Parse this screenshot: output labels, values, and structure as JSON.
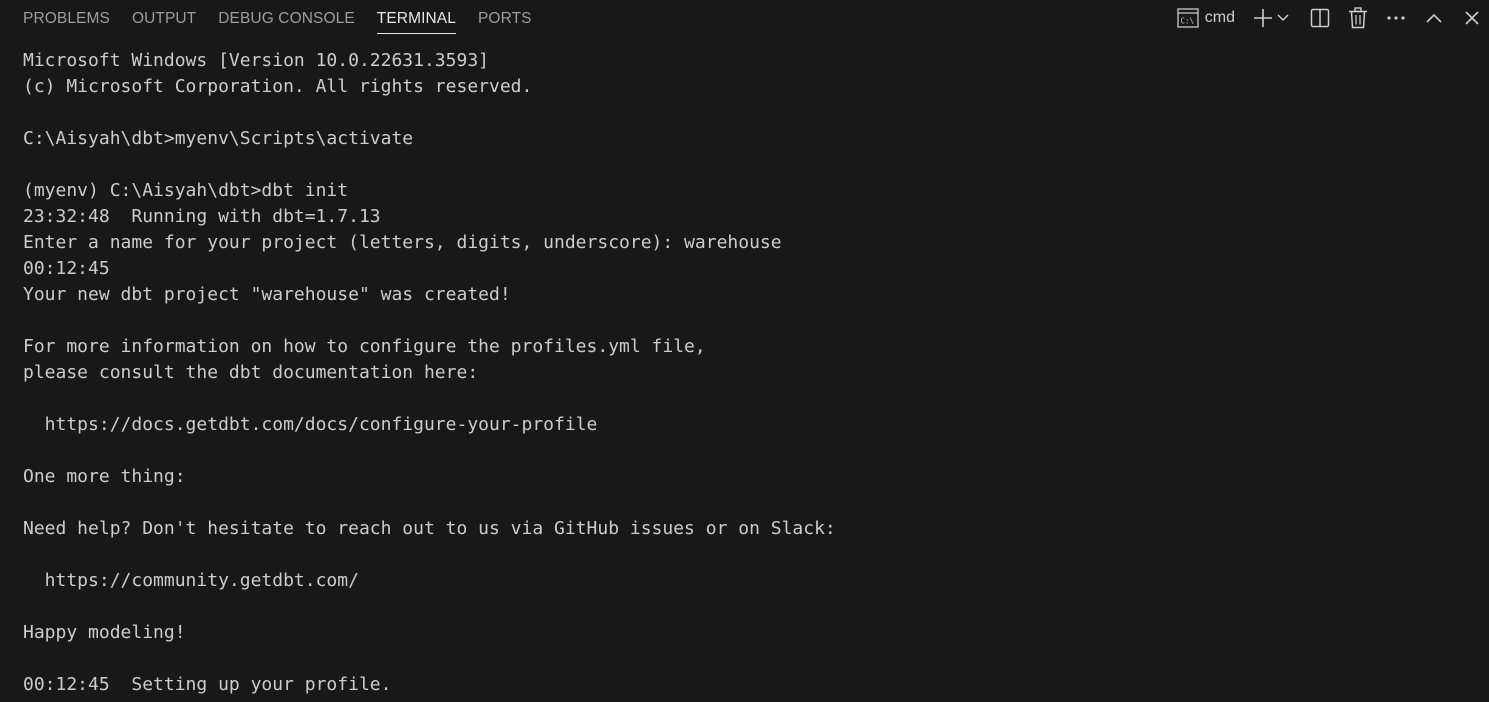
{
  "panel": {
    "tabs": [
      {
        "label": "PROBLEMS",
        "active": false
      },
      {
        "label": "OUTPUT",
        "active": false
      },
      {
        "label": "DEBUG CONSOLE",
        "active": false
      },
      {
        "label": "TERMINAL",
        "active": true
      },
      {
        "label": "PORTS",
        "active": false
      }
    ],
    "actions": {
      "terminal_name": "cmd",
      "icons": [
        "terminal-icon",
        "plus-icon",
        "chevron-down-icon",
        "split-icon",
        "trash-icon",
        "ellipsis-icon",
        "chevron-up-icon",
        "close-icon"
      ]
    }
  },
  "terminal": {
    "lines": [
      "Microsoft Windows [Version 10.0.22631.3593]",
      "(c) Microsoft Corporation. All rights reserved.",
      "",
      "C:\\Aisyah\\dbt>myenv\\Scripts\\activate",
      "",
      "(myenv) C:\\Aisyah\\dbt>dbt init",
      "23:32:48  Running with dbt=1.7.13",
      "Enter a name for your project (letters, digits, underscore): warehouse",
      "00:12:45",
      "Your new dbt project \"warehouse\" was created!",
      "",
      "For more information on how to configure the profiles.yml file,",
      "please consult the dbt documentation here:",
      "",
      "  https://docs.getdbt.com/docs/configure-your-profile",
      "",
      "One more thing:",
      "",
      "Need help? Don't hesitate to reach out to us via GitHub issues or on Slack:",
      "",
      "  https://community.getdbt.com/",
      "",
      "Happy modeling!",
      "",
      "00:12:45  Setting up your profile."
    ]
  },
  "colors": {
    "background": "#181818",
    "foreground": "#cccccc",
    "tab_inactive": "#9d9d9d",
    "tab_active": "#e7e7e7"
  }
}
